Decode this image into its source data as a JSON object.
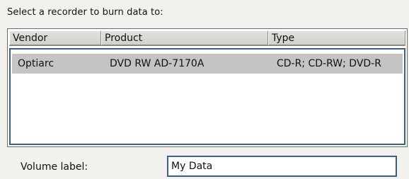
{
  "prompt": "Select a recorder to burn data to:",
  "table": {
    "columns": [
      "Vendor",
      "Product",
      "Type"
    ],
    "rows": [
      {
        "vendor": "Optiarc",
        "product": "DVD RW AD-7170A",
        "type": "CD-R; CD-RW; DVD-R",
        "selected": true
      }
    ]
  },
  "volume": {
    "label": "Volume label:",
    "value": "My Data"
  },
  "colors": {
    "background": "#f3f1ee",
    "selection": "#c5c4c2",
    "focus_border": "#3a5f8c"
  }
}
